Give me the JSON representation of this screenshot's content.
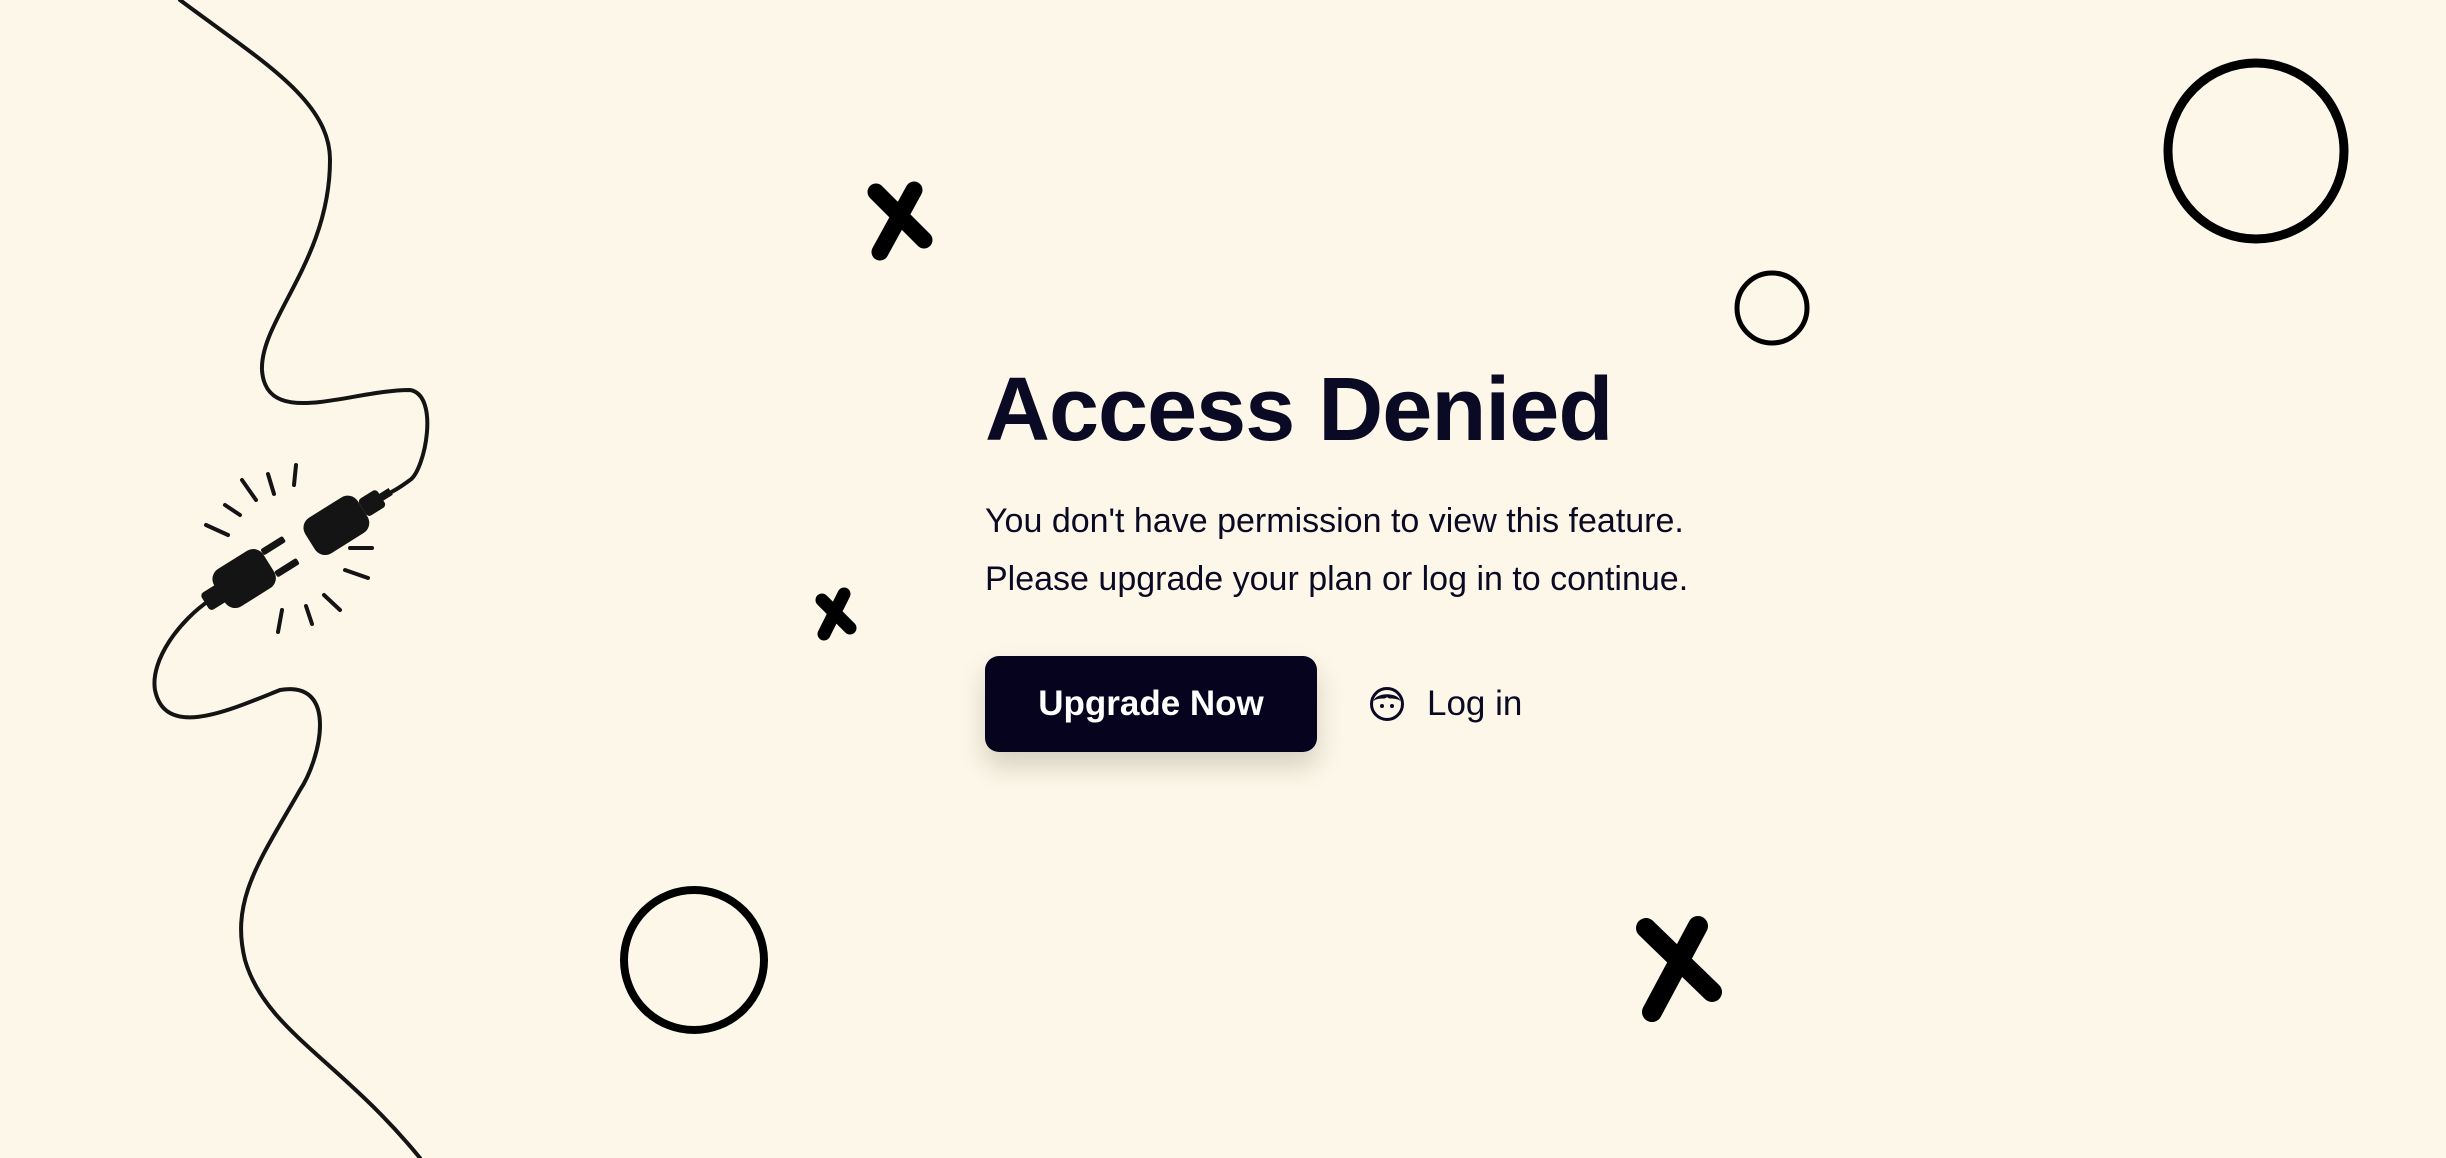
{
  "page": {
    "title": "Access Denied",
    "message_lines": [
      "You don't have permission to view this feature.",
      "Please upgrade your plan or log in to continue."
    ]
  },
  "actions": {
    "upgrade_label": "Upgrade Now",
    "login_label": "Log in"
  },
  "icons": {
    "login": "user-face-icon",
    "illustration": "unplugged-cable-icon"
  },
  "colors": {
    "background": "#fcf7e8",
    "text": "#0b0a24",
    "primary_button": "#06031f",
    "primary_button_text": "#ffffff",
    "decoration": "#000000"
  }
}
